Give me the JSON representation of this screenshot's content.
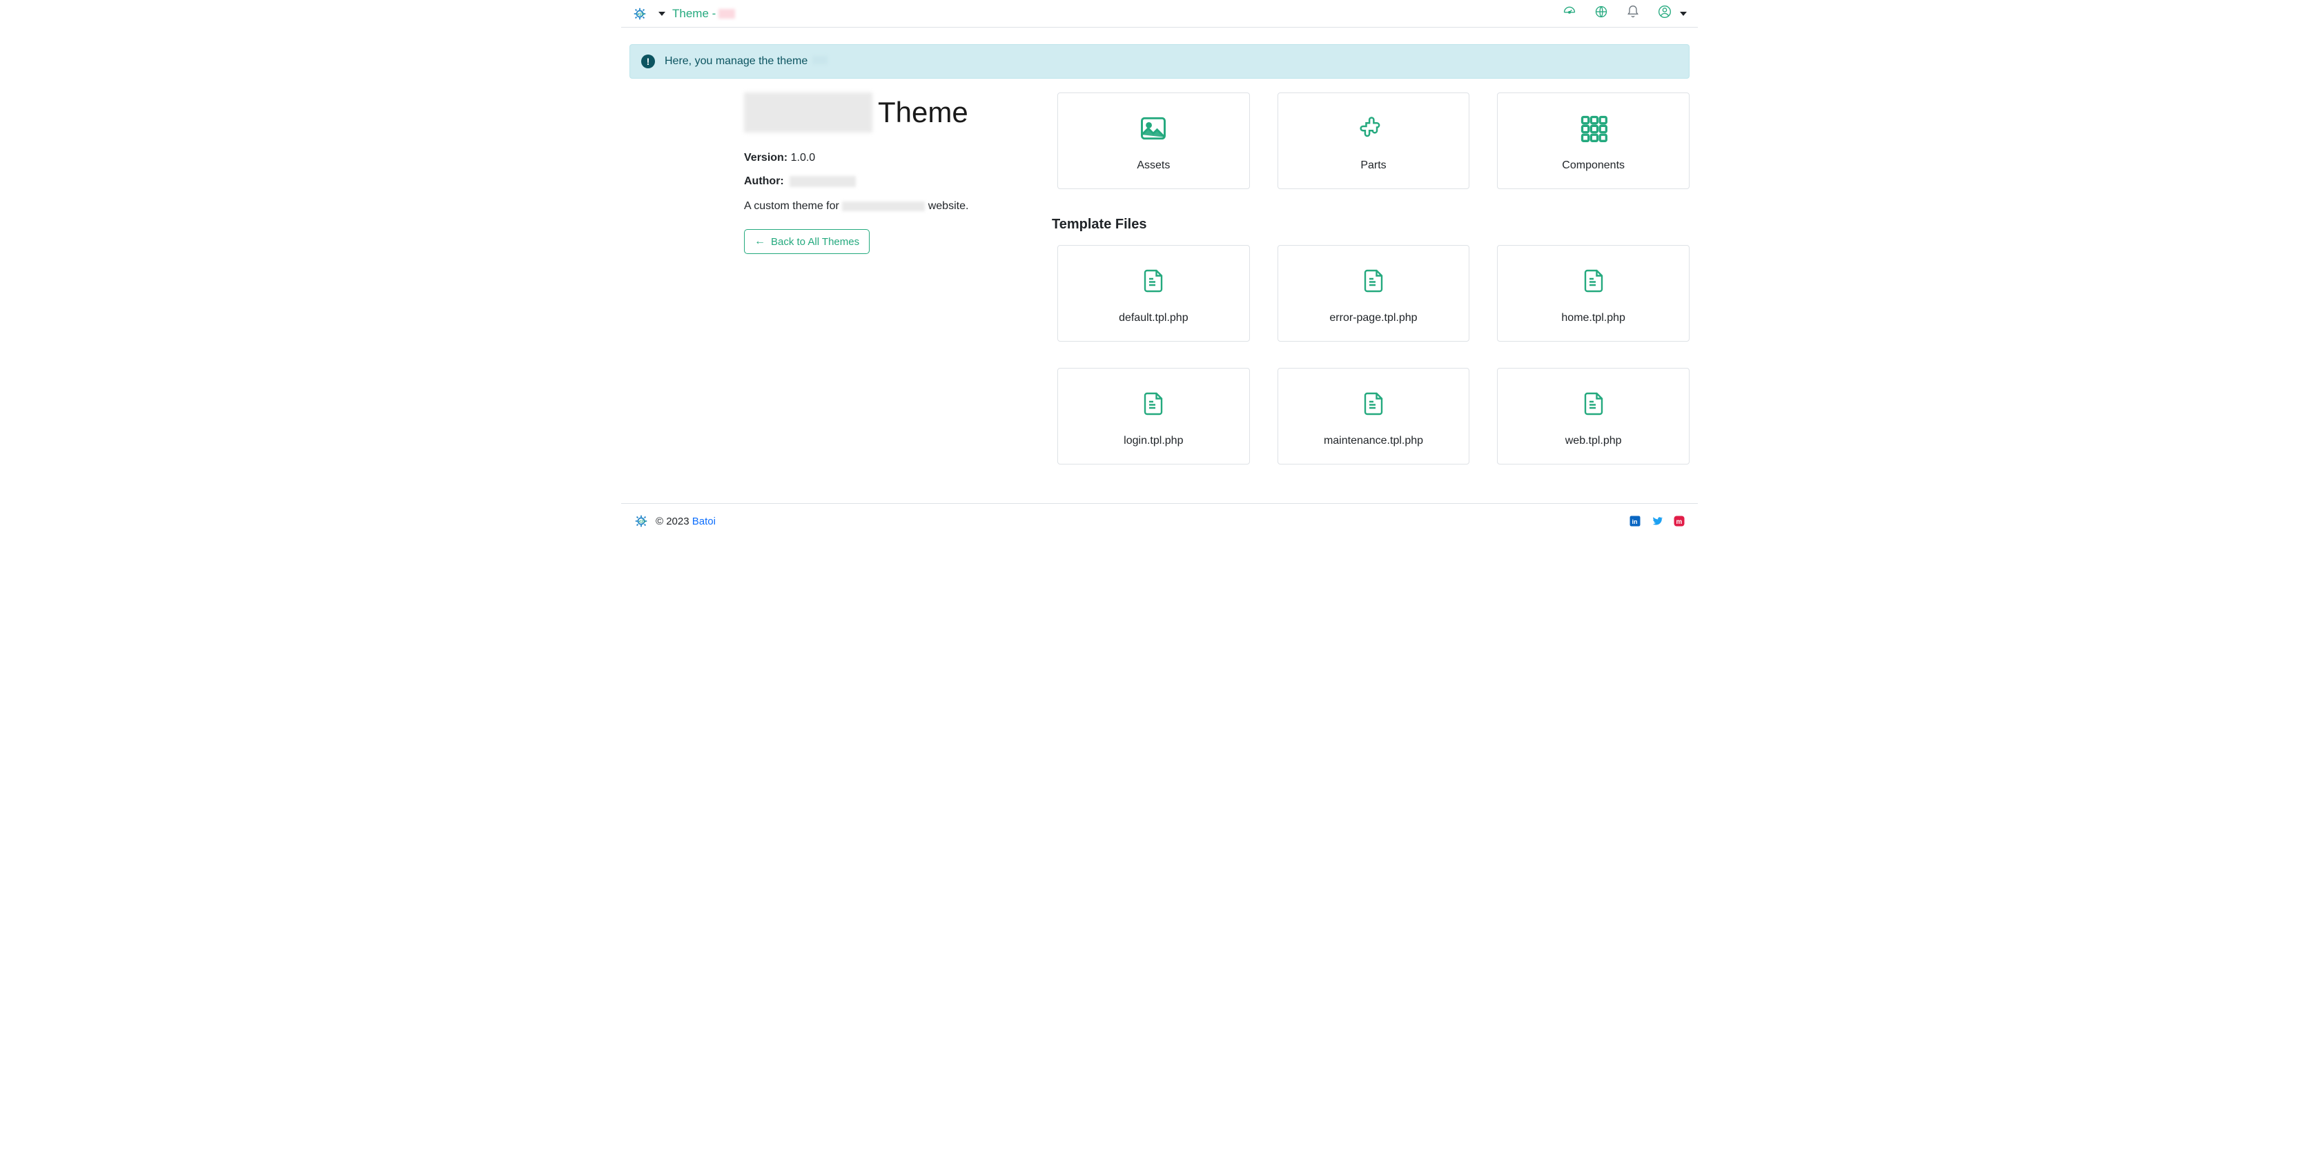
{
  "header": {
    "breadcrumb_prefix": "Theme - "
  },
  "alert": {
    "text": "Here, you manage the theme"
  },
  "theme": {
    "title_suffix": "Theme",
    "version_label": "Version:",
    "version_value": "1.0.0",
    "author_label": "Author:",
    "desc_prefix": "A custom theme for ",
    "desc_suffix": " website.",
    "back_label": "Back to All Themes"
  },
  "modules": {
    "assets": "Assets",
    "parts": "Parts",
    "components": "Components"
  },
  "templates": {
    "heading": "Template Files",
    "files": {
      "f0": "default.tpl.php",
      "f1": "error-page.tpl.php",
      "f2": "home.tpl.php",
      "f3": "login.tpl.php",
      "f4": "maintenance.tpl.php",
      "f5": "web.tpl.php"
    }
  },
  "footer": {
    "copyright": "© 2023 ",
    "brand": "Batoi"
  }
}
